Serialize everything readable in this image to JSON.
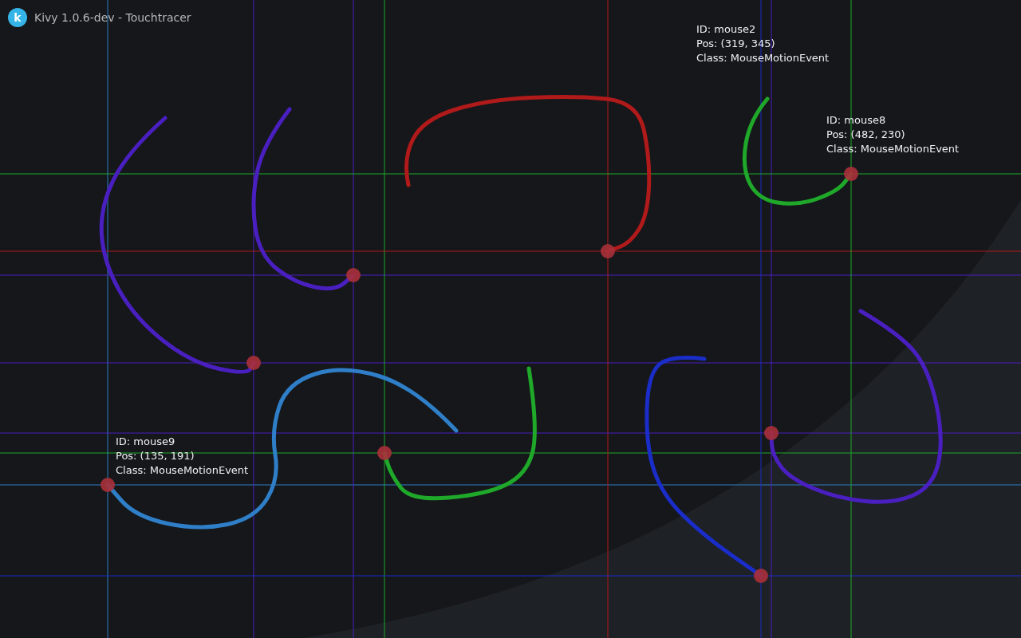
{
  "window": {
    "title": "Kivy 1.0.6-dev - Touchtracer",
    "logo_letter": "k"
  },
  "touches": [
    {
      "color": "#2f7fc8",
      "label": {
        "id": "ID: mouse9",
        "pos": "Pos: (135, 191)",
        "class": "Class: MouseMotionEvent"
      }
    },
    {
      "color": "#4a1fc0",
      "label": {
        "id": "ID: mouse2",
        "pos": "Pos: (319, 345)",
        "class": "Class: MouseMotionEvent"
      }
    },
    {
      "color": "#4a1fc0"
    },
    {
      "color": "#1fa82a",
      "label": {
        "id": "ID: mouse8",
        "pos": "Pos: (482, 230)",
        "class": "Class: MouseMotionEvent"
      }
    },
    {
      "color": "#b01a1a"
    },
    {
      "color": "#1a2dc8"
    },
    {
      "color": "#4a1fc0"
    },
    {
      "color": "#1fa82a"
    }
  ]
}
